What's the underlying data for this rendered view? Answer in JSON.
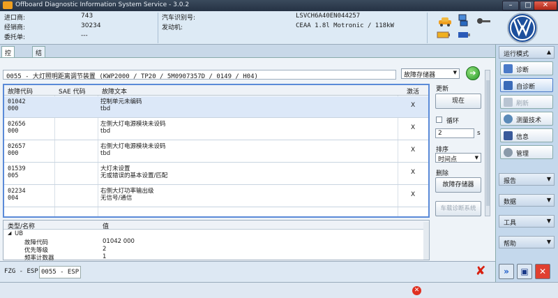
{
  "window": {
    "title": "Offboard Diagnostic Information System Service - 3.0.2"
  },
  "header": {
    "import_label": "进口商:",
    "import_value": "743",
    "dealer_label": "经销商:",
    "dealer_value": "30234",
    "client_label": "委托单:",
    "client_value": "---",
    "vin_label": "汽车识别号:",
    "vin_value": "LSVCH6A40EN044257",
    "engine_label": "发动机:",
    "engine_value": "CEAA 1.8l Motronic / 118kW"
  },
  "tabs": [
    {
      "label": "控制单元"
    },
    {
      "label": "结果"
    }
  ],
  "ecu": {
    "line": "0055 - 大灯照明距离调节装置  (KWP2000 / TP20 / 5M0907357D   / 0149 / H04)",
    "memory_select": "故障存储器"
  },
  "fault_table": {
    "headers": {
      "code": "故障代码",
      "sae": "SAE 代码",
      "text": "故障文本",
      "active": "激活"
    },
    "rows": [
      {
        "code1": "01042",
        "code2": "000",
        "text1": "控制单元未编码",
        "text2": "tbd",
        "active": "X"
      },
      {
        "code1": "02656",
        "code2": "000",
        "text1": "左侧大灯电源模块未设码",
        "text2": "tbd",
        "active": "X"
      },
      {
        "code1": "02657",
        "code2": "000",
        "text1": "右侧大灯电源模块未设码",
        "text2": "tbd",
        "active": "X"
      },
      {
        "code1": "01539",
        "code2": "005",
        "text1": "大灯未设置",
        "text2": "无或错误的基本设置/匹配",
        "active": "X"
      },
      {
        "code1": "02234",
        "code2": "004",
        "text1": "右侧大灯功率输出级",
        "text2": "无信号/通信",
        "active": "X"
      }
    ]
  },
  "controls": {
    "refresh_label": "更新",
    "now_button": "现在",
    "loop_label": "循环",
    "interval_value": "2",
    "interval_unit": "s",
    "sort_label": "排序",
    "sort_value": "时间点",
    "delete_label": "删除",
    "delete_button": "故障存储器",
    "vehicle_diag_button": "车载诊断系统"
  },
  "detail_table": {
    "headers": {
      "type": "类型/名称",
      "value": "值"
    },
    "group": "UB",
    "rows": [
      {
        "name": "故障代码",
        "value": "01042 000"
      },
      {
        "name": "优先等级",
        "value": "2"
      },
      {
        "name": "频率计数器",
        "value": "1"
      }
    ]
  },
  "bottom_tabs": [
    {
      "label": "FZG - ESP"
    },
    {
      "label": "0055 - ESP"
    }
  ],
  "sidebar": {
    "run_mode": "运行模式",
    "buttons": [
      {
        "label": "诊断"
      },
      {
        "label": "自诊断"
      },
      {
        "label": "刷新"
      },
      {
        "label": "测量技术"
      },
      {
        "label": "信息"
      },
      {
        "label": "管理"
      }
    ],
    "sections": [
      {
        "label": "报告"
      },
      {
        "label": "数据"
      },
      {
        "label": "工具"
      },
      {
        "label": "帮助"
      }
    ]
  },
  "colors": {
    "accent": "#5a8ad8",
    "close": "#d82010",
    "go": "#2a9a2a"
  }
}
